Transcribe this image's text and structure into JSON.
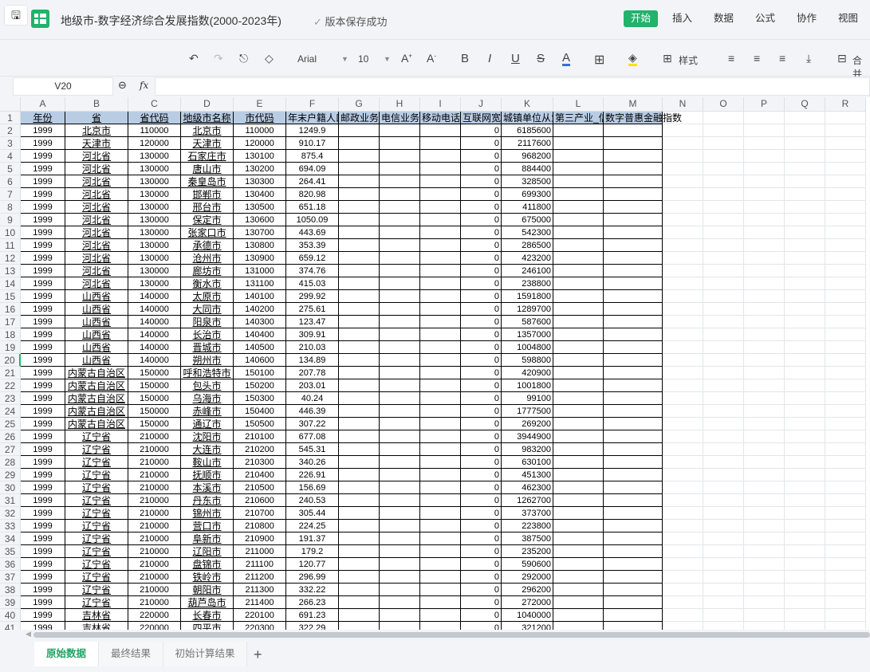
{
  "app": {
    "title": "地级市-数字经济综合发展指数(2000-2023年)",
    "save_status": "版本保存成功",
    "accent": "#21b26b"
  },
  "menu": [
    "开始",
    "插入",
    "数据",
    "公式",
    "协作",
    "视图"
  ],
  "toolbar": {
    "font": "Arial",
    "size": "10",
    "style_label": "样式",
    "merge_label": "合并"
  },
  "formula": {
    "cell_ref": "V20",
    "fx": "fx",
    "value": ""
  },
  "columns": [
    "A",
    "B",
    "C",
    "D",
    "E",
    "F",
    "G",
    "H",
    "I",
    "J",
    "K",
    "L",
    "M",
    "N",
    "O",
    "P",
    "Q",
    "R"
  ],
  "headers": [
    "年份",
    "省",
    "省代码",
    "地级市名称",
    "市代码",
    "年末户籍人口",
    "邮政业务",
    "电信业务",
    "移动电话",
    "互联网宽",
    "城镇单位从业",
    "第三产业_信",
    "数字普惠金融指数"
  ],
  "rows": [
    [
      "1999",
      "北京市",
      "110000",
      "北京市",
      "110000",
      "1249.9",
      "0",
      "6185600"
    ],
    [
      "1999",
      "天津市",
      "120000",
      "天津市",
      "120000",
      "910.17",
      "0",
      "2117600"
    ],
    [
      "1999",
      "河北省",
      "130000",
      "石家庄市",
      "130100",
      "875.4",
      "0",
      "968200"
    ],
    [
      "1999",
      "河北省",
      "130000",
      "唐山市",
      "130200",
      "694.09",
      "0",
      "884400"
    ],
    [
      "1999",
      "河北省",
      "130000",
      "秦皇岛市",
      "130300",
      "264.41",
      "0",
      "328500"
    ],
    [
      "1999",
      "河北省",
      "130000",
      "邯郸市",
      "130400",
      "820.98",
      "0",
      "699300"
    ],
    [
      "1999",
      "河北省",
      "130000",
      "邢台市",
      "130500",
      "651.18",
      "0",
      "411800"
    ],
    [
      "1999",
      "河北省",
      "130000",
      "保定市",
      "130600",
      "1050.09",
      "0",
      "675000"
    ],
    [
      "1999",
      "河北省",
      "130000",
      "张家口市",
      "130700",
      "443.69",
      "0",
      "542300"
    ],
    [
      "1999",
      "河北省",
      "130000",
      "承德市",
      "130800",
      "353.39",
      "0",
      "286500"
    ],
    [
      "1999",
      "河北省",
      "130000",
      "沧州市",
      "130900",
      "659.12",
      "0",
      "423200"
    ],
    [
      "1999",
      "河北省",
      "130000",
      "廊坊市",
      "131000",
      "374.76",
      "0",
      "246100"
    ],
    [
      "1999",
      "河北省",
      "130000",
      "衡水市",
      "131100",
      "415.03",
      "0",
      "238800"
    ],
    [
      "1999",
      "山西省",
      "140000",
      "太原市",
      "140100",
      "299.92",
      "0",
      "1591800"
    ],
    [
      "1999",
      "山西省",
      "140000",
      "大同市",
      "140200",
      "275.61",
      "0",
      "1289700"
    ],
    [
      "1999",
      "山西省",
      "140000",
      "阳泉市",
      "140300",
      "123.47",
      "0",
      "587600"
    ],
    [
      "1999",
      "山西省",
      "140000",
      "长治市",
      "140400",
      "309.91",
      "0",
      "1357000"
    ],
    [
      "1999",
      "山西省",
      "140000",
      "晋城市",
      "140500",
      "210.03",
      "0",
      "1004800"
    ],
    [
      "1999",
      "山西省",
      "140000",
      "朔州市",
      "140600",
      "134.89",
      "0",
      "598800"
    ],
    [
      "1999",
      "内蒙古自治区",
      "150000",
      "呼和浩特市",
      "150100",
      "207.78",
      "0",
      "420900"
    ],
    [
      "1999",
      "内蒙古自治区",
      "150000",
      "包头市",
      "150200",
      "203.01",
      "0",
      "1001800"
    ],
    [
      "1999",
      "内蒙古自治区",
      "150000",
      "乌海市",
      "150300",
      "40.24",
      "0",
      "99100"
    ],
    [
      "1999",
      "内蒙古自治区",
      "150000",
      "赤峰市",
      "150400",
      "446.39",
      "0",
      "1777500"
    ],
    [
      "1999",
      "内蒙古自治区",
      "150000",
      "通辽市",
      "150500",
      "307.22",
      "0",
      "269200"
    ],
    [
      "1999",
      "辽宁省",
      "210000",
      "沈阳市",
      "210100",
      "677.08",
      "0",
      "3944900"
    ],
    [
      "1999",
      "辽宁省",
      "210000",
      "大连市",
      "210200",
      "545.31",
      "0",
      "983200"
    ],
    [
      "1999",
      "辽宁省",
      "210000",
      "鞍山市",
      "210300",
      "340.26",
      "0",
      "630100"
    ],
    [
      "1999",
      "辽宁省",
      "210000",
      "抚顺市",
      "210400",
      "226.91",
      "0",
      "451300"
    ],
    [
      "1999",
      "辽宁省",
      "210000",
      "本溪市",
      "210500",
      "156.69",
      "0",
      "462300"
    ],
    [
      "1999",
      "辽宁省",
      "210000",
      "丹东市",
      "210600",
      "240.53",
      "0",
      "1262700"
    ],
    [
      "1999",
      "辽宁省",
      "210000",
      "锦州市",
      "210700",
      "305.44",
      "0",
      "373700"
    ],
    [
      "1999",
      "辽宁省",
      "210000",
      "营口市",
      "210800",
      "224.25",
      "0",
      "223800"
    ],
    [
      "1999",
      "辽宁省",
      "210000",
      "阜新市",
      "210900",
      "191.37",
      "0",
      "387500"
    ],
    [
      "1999",
      "辽宁省",
      "210000",
      "辽阳市",
      "211000",
      "179.2",
      "0",
      "235200"
    ],
    [
      "1999",
      "辽宁省",
      "210000",
      "盘锦市",
      "211100",
      "120.77",
      "0",
      "590600"
    ],
    [
      "1999",
      "辽宁省",
      "210000",
      "铁岭市",
      "211200",
      "296.99",
      "0",
      "292000"
    ],
    [
      "1999",
      "辽宁省",
      "210000",
      "朝阳市",
      "211300",
      "332.22",
      "0",
      "296200"
    ],
    [
      "1999",
      "辽宁省",
      "210000",
      "葫芦岛市",
      "211400",
      "266.23",
      "0",
      "272000"
    ],
    [
      "1999",
      "吉林省",
      "220000",
      "长春市",
      "220100",
      "691.23",
      "0",
      "1040000"
    ],
    [
      "1999",
      "吉林省",
      "220000",
      "四平市",
      "220300",
      "322.29",
      "0",
      "321200"
    ]
  ],
  "sheets": [
    "原始数据",
    "最终结果",
    "初始计算结果"
  ],
  "add_sheet": "+"
}
